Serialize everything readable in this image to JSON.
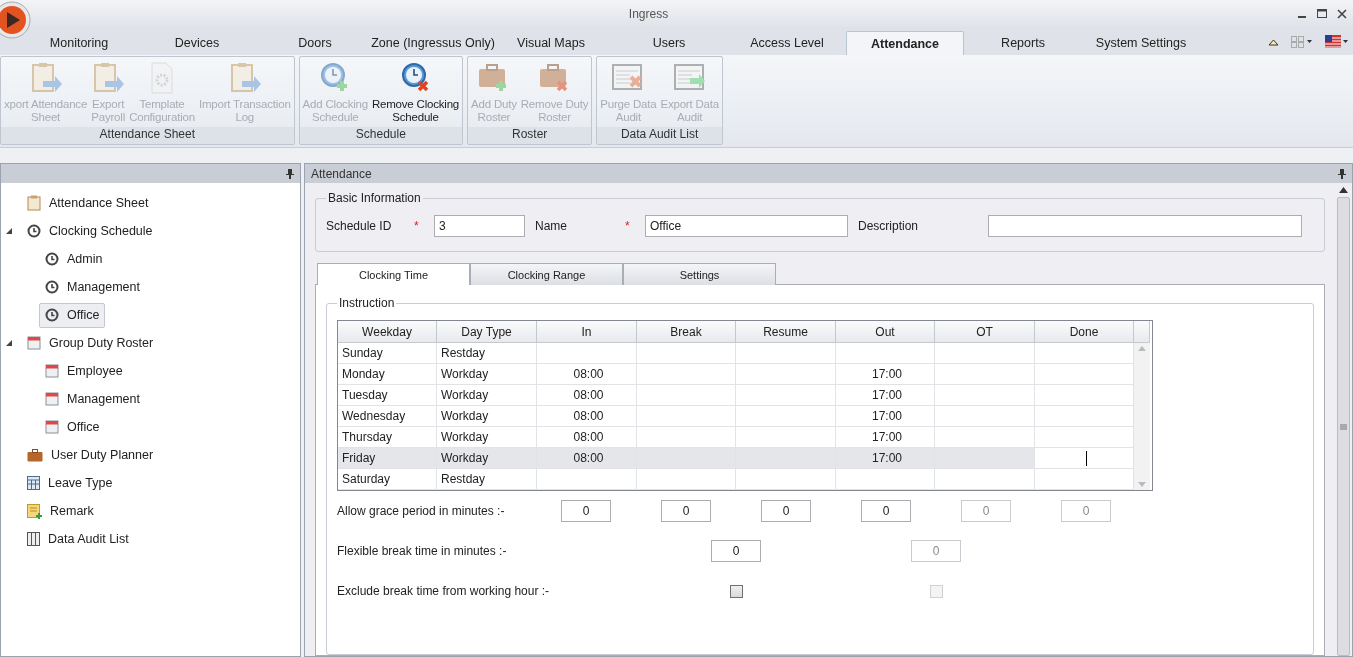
{
  "window": {
    "title": "Ingress"
  },
  "tabs": [
    {
      "label": "Monitoring",
      "selected": false
    },
    {
      "label": "Devices",
      "selected": false
    },
    {
      "label": "Doors",
      "selected": false
    },
    {
      "label": "Zone (Ingressus Only)",
      "selected": false
    },
    {
      "label": "Visual Maps",
      "selected": false
    },
    {
      "label": "Users",
      "selected": false
    },
    {
      "label": "Access Level",
      "selected": false
    },
    {
      "label": "Attendance",
      "selected": true
    },
    {
      "label": "Reports",
      "selected": false
    },
    {
      "label": "System Settings",
      "selected": false
    }
  ],
  "ribbon": [
    {
      "title": "Attendance Sheet",
      "buttons": [
        {
          "label": "xport Attendance\nSheet",
          "kind": "clipboard",
          "disabled": true
        },
        {
          "label": "Export\nPayroll",
          "kind": "clipboard",
          "disabled": true
        },
        {
          "label": "Template\nConfiguration",
          "kind": "gear",
          "disabled": true
        },
        {
          "label": "Import Transaction\nLog",
          "kind": "clipboard",
          "disabled": true
        }
      ]
    },
    {
      "title": "Schedule",
      "buttons": [
        {
          "label": "Add Clocking\nSchedule",
          "kind": "clock-add",
          "disabled": true
        },
        {
          "label": "Remove Clocking\nSchedule",
          "kind": "clock-remove",
          "disabled": false
        }
      ]
    },
    {
      "title": "Roster",
      "buttons": [
        {
          "label": "Add Duty\nRoster",
          "kind": "case-add",
          "disabled": true
        },
        {
          "label": "Remove Duty\nRoster",
          "kind": "case-remove",
          "disabled": true
        }
      ]
    },
    {
      "title": "Data Audit List",
      "buttons": [
        {
          "label": "Purge Data\nAudit",
          "kind": "sheet-remove",
          "disabled": true
        },
        {
          "label": "Export Data\nAudit",
          "kind": "sheet-export",
          "disabled": true
        }
      ]
    }
  ],
  "tree": [
    {
      "label": "Attendance Sheet",
      "kind": "clipboard",
      "selected": false
    },
    {
      "label": "Clocking Schedule",
      "kind": "clock",
      "selected": false,
      "expanded": true,
      "children": [
        {
          "label": "Admin",
          "kind": "clock",
          "selected": false
        },
        {
          "label": "Management",
          "kind": "clock",
          "selected": false
        },
        {
          "label": "Office",
          "kind": "clock",
          "selected": true
        }
      ]
    },
    {
      "label": "Group Duty Roster",
      "kind": "calendar",
      "selected": false,
      "expanded": true,
      "children": [
        {
          "label": "Employee",
          "kind": "calendar",
          "selected": false
        },
        {
          "label": "Management",
          "kind": "calendar",
          "selected": false
        },
        {
          "label": "Office",
          "kind": "calendar",
          "selected": false
        }
      ]
    },
    {
      "label": "User Duty Planner",
      "kind": "briefcase",
      "selected": false
    },
    {
      "label": "Leave Type",
      "kind": "table",
      "selected": false
    },
    {
      "label": "Remark",
      "kind": "note",
      "selected": false
    },
    {
      "label": "Data Audit List",
      "kind": "sheet",
      "selected": false
    }
  ],
  "panel": {
    "title": "Attendance",
    "basic_information": {
      "title": "Basic Information",
      "fields": [
        {
          "label": "Schedule ID",
          "required_mark": "*",
          "value": "3"
        },
        {
          "label": "Name",
          "required_mark": "*",
          "value": "Office"
        },
        {
          "label": "Description"
        }
      ]
    },
    "tabs": [
      {
        "label": "Clocking Time",
        "selected": true
      },
      {
        "label": "Clocking Range",
        "selected": false
      },
      {
        "label": "Settings",
        "selected": false
      }
    ],
    "instruction": {
      "title": "Instruction",
      "columns": [
        "Weekday",
        "Day Type",
        "In",
        "Break",
        "Resume",
        "Out",
        "OT",
        "Done"
      ],
      "rows": [
        {
          "cells": [
            "Sunday",
            "Restday",
            "",
            "",
            "",
            "",
            "",
            ""
          ],
          "selected": false
        },
        {
          "cells": [
            "Monday",
            "Workday",
            "08:00",
            "",
            "",
            "17:00",
            "",
            ""
          ],
          "selected": false
        },
        {
          "cells": [
            "Tuesday",
            "Workday",
            "08:00",
            "",
            "",
            "17:00",
            "",
            ""
          ],
          "selected": false
        },
        {
          "cells": [
            "Wednesday",
            "Workday",
            "08:00",
            "",
            "",
            "17:00",
            "",
            ""
          ],
          "selected": false
        },
        {
          "cells": [
            "Thursday",
            "Workday",
            "08:00",
            "",
            "",
            "17:00",
            "",
            ""
          ],
          "selected": false
        },
        {
          "cells": [
            "Friday",
            "Workday",
            "08:00",
            "",
            "",
            "17:00",
            "",
            ""
          ],
          "selected": true
        },
        {
          "cells": [
            "Saturday",
            "Restday",
            "",
            "",
            "",
            "",
            "",
            ""
          ],
          "selected": false
        }
      ],
      "grace": {
        "label": "Allow grace period in minutes :-",
        "inputs": [
          {
            "value": "0",
            "disabled": false
          },
          {
            "value": "0",
            "disabled": false
          },
          {
            "value": "0",
            "disabled": false
          },
          {
            "value": "0",
            "disabled": false
          },
          {
            "value": "0",
            "disabled": true
          },
          {
            "value": "0",
            "disabled": true
          }
        ]
      },
      "flexible": {
        "label": "Flexible break time in minutes :-",
        "inputs": [
          {
            "value": "0",
            "disabled": false
          },
          {
            "value": "0",
            "disabled": true
          }
        ]
      },
      "exclude": {
        "label": "Exclude break time from working hour :-",
        "checkboxes": [
          {
            "checked": false,
            "disabled": false
          },
          {
            "checked": false,
            "disabled": true
          }
        ]
      }
    }
  }
}
